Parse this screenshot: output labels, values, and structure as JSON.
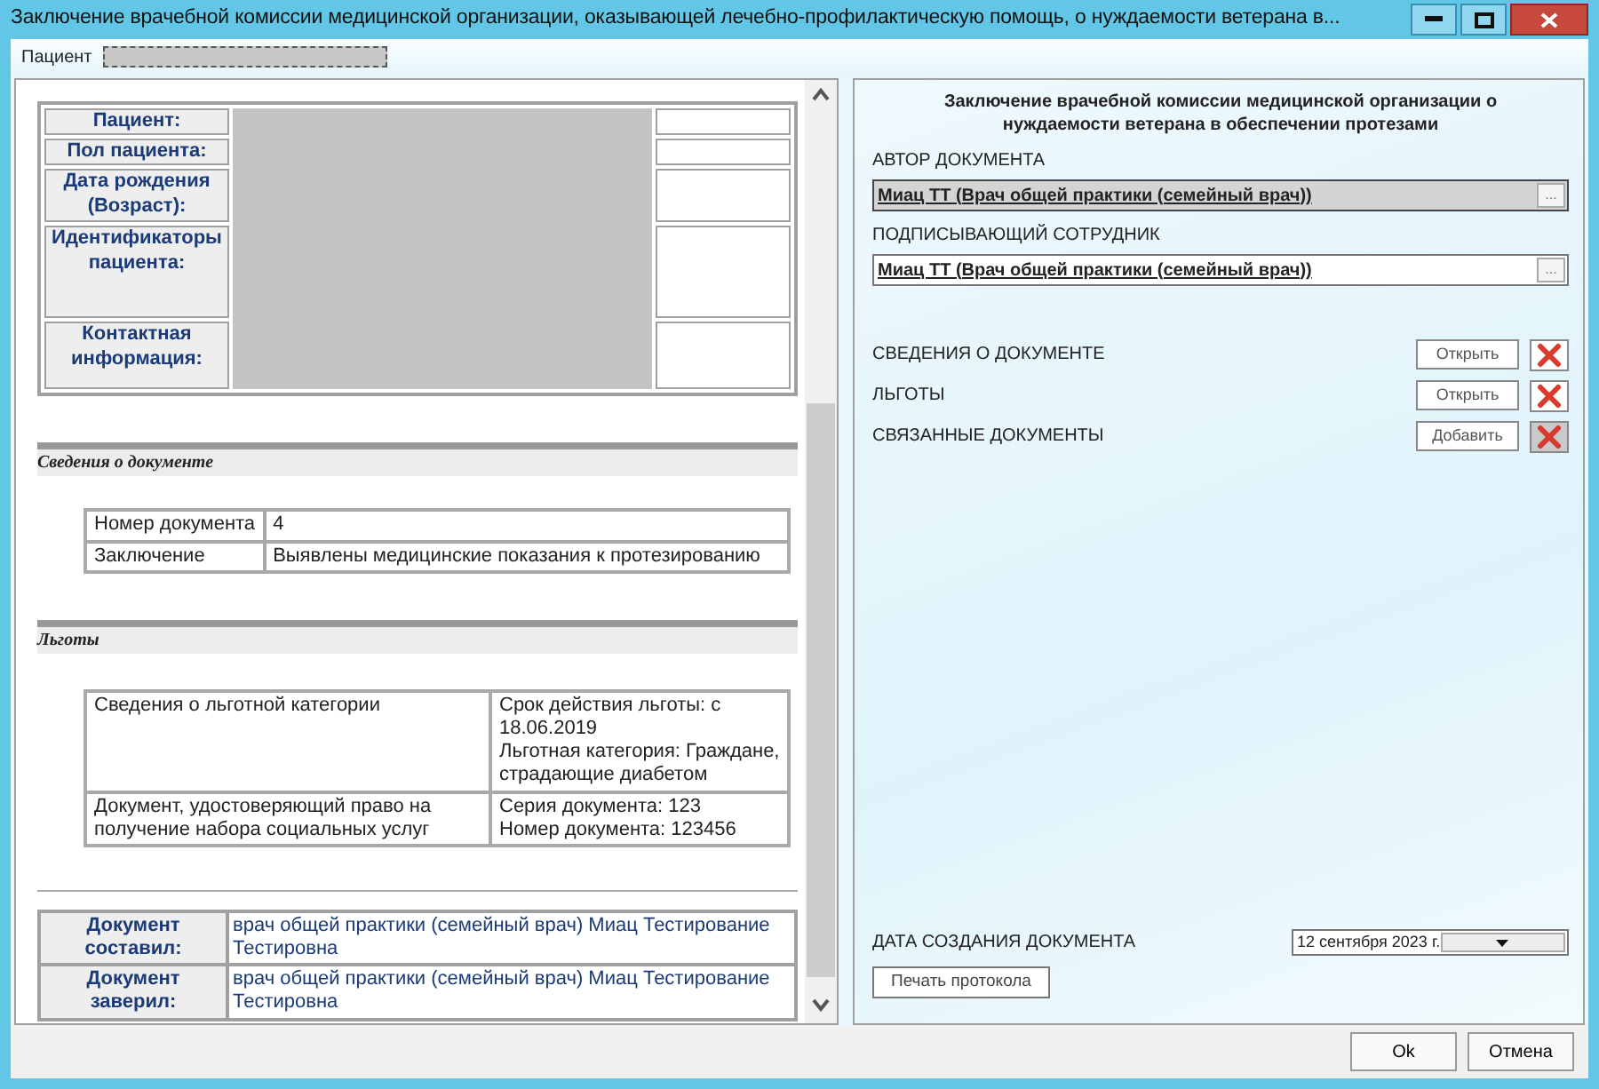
{
  "window": {
    "title": "Заключение врачебной комиссии медицинской организации, оказывающей лечебно-профилактическую помощь, о нуждаемости ветерана в..."
  },
  "patient_bar": {
    "label": "Пациент"
  },
  "report": {
    "patient_rows": [
      {
        "label": "Пациент:"
      },
      {
        "label": "Пол пациента:"
      },
      {
        "label": "Дата рождения (Возраст):"
      },
      {
        "label": "Идентификаторы пациента:"
      },
      {
        "label": "Контактная информация:"
      }
    ],
    "sections": [
      {
        "title": "Сведения о документе",
        "rows": [
          [
            [
              "Номер документа"
            ],
            [
              "4"
            ]
          ],
          [
            [
              "Заключение"
            ],
            [
              "Выявлены медицинские показания к протезированию"
            ]
          ]
        ]
      },
      {
        "title": "Льготы",
        "rows": [
          [
            [
              "Сведения о льготной категории"
            ],
            [
              "Срок действия льготы: с 18.06.2019",
              "Льготная категория: Граждане, страдающие диабетом"
            ]
          ],
          [
            [
              "Документ, удостоверяющий право на получение набора социальных услуг"
            ],
            [
              "Серия документа: 123",
              "Номер документа: 123456"
            ]
          ]
        ]
      }
    ],
    "signatures": [
      {
        "label": "Документ составил:",
        "value": "врач общей практики (семейный врач) Миац Тестирование Тестировна"
      },
      {
        "label": "Документ заверил:",
        "value": "врач общей практики (семейный врач) Миац Тестирование Тестировна"
      }
    ]
  },
  "form": {
    "title": "Заключение врачебной комиссии медицинской организации о нуждаемости ветерана в обеспечении протезами",
    "fields": [
      {
        "label": "АВТОР ДОКУМЕНТА",
        "value": "Миац ТТ (Врач общей практики (семейный врач))",
        "button": "...",
        "disabled": true
      },
      {
        "label": "ПОДПИСЫВАЮЩИЙ СОТРУДНИК",
        "value": "Миац ТТ (Врач общей практики (семейный врач))",
        "button": "...",
        "disabled": false
      }
    ],
    "attachments": [
      {
        "label": "СВЕДЕНИЯ О ДОКУМЕНТЕ",
        "action": "Открыть",
        "delete_disabled": false
      },
      {
        "label": "ЛЬГОТЫ",
        "action": "Открыть",
        "delete_disabled": false
      },
      {
        "label": "СВЯЗАННЫЕ ДОКУМЕНТЫ",
        "action": "Добавить",
        "delete_disabled": true
      }
    ],
    "date": {
      "label": "ДАТА СОЗДАНИЯ ДОКУМЕНТА",
      "value": "12 сентября 2023 г."
    },
    "print_button": "Печать протокола"
  },
  "buttons": [
    "Ok",
    "Отмена"
  ]
}
